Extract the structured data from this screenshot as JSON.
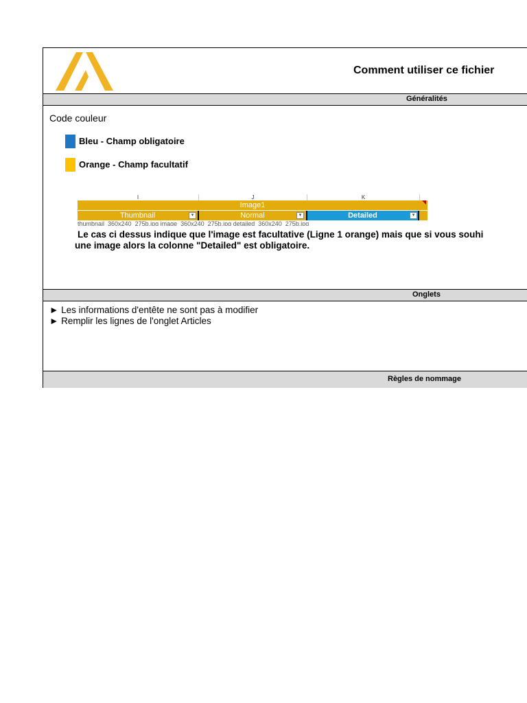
{
  "header": {
    "title": "Comment utiliser ce fichier",
    "logo_icon": "logo-icon"
  },
  "sections": {
    "generalites": "Généralités",
    "onglets": "Onglets",
    "regles": "Règles de nommage"
  },
  "color_code": {
    "label": "Code couleur",
    "items": [
      {
        "color": "#1f77c4",
        "label": "Bleu - Champ obligatoire"
      },
      {
        "color": "#ffc000",
        "label": "Orange - Champ facultatif"
      }
    ]
  },
  "snippet": {
    "col_letters": [
      "I",
      "J",
      "K"
    ],
    "group_header": "Image1",
    "columns": [
      "Thumbnail",
      "Normal",
      "Detailed"
    ],
    "cut_row": "    thumbnail_360x240_275b.jpg     image_360x240_275b.jpg    detailed_360x240_275b.jpg"
  },
  "note": {
    "line1": "Le cas ci dessus indique que l'image est facultative (Ligne 1 orange) mais que si vous souhi",
    "line2": "une image alors la colonne \"Detailed\" est obligatoire."
  },
  "onglets_bullets": [
    "► Les informations d'entête ne sont pas à modifier",
    "► Remplir les lignes de l'onglet Articles"
  ]
}
